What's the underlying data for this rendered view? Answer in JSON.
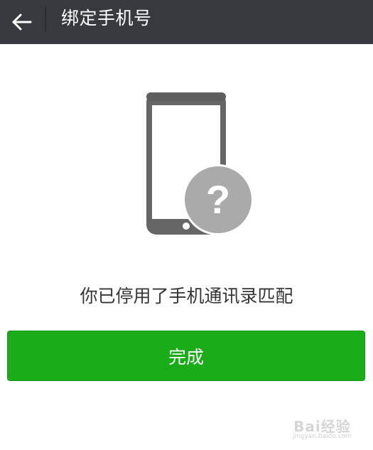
{
  "header": {
    "back_icon": "arrow-left-icon",
    "title": "绑定手机号"
  },
  "main": {
    "illustration_icon": "phone-question-icon",
    "message": "你已停用了手机通讯录匹配",
    "done_button_label": "完成"
  },
  "watermark": {
    "brand": "Bai经验",
    "url": "jingyan.baidu.com"
  },
  "colors": {
    "header_bg": "#393a3f",
    "button_green": "#1aad19",
    "phone_gray": "#666666",
    "badge_gray": "#aaaaaa"
  }
}
